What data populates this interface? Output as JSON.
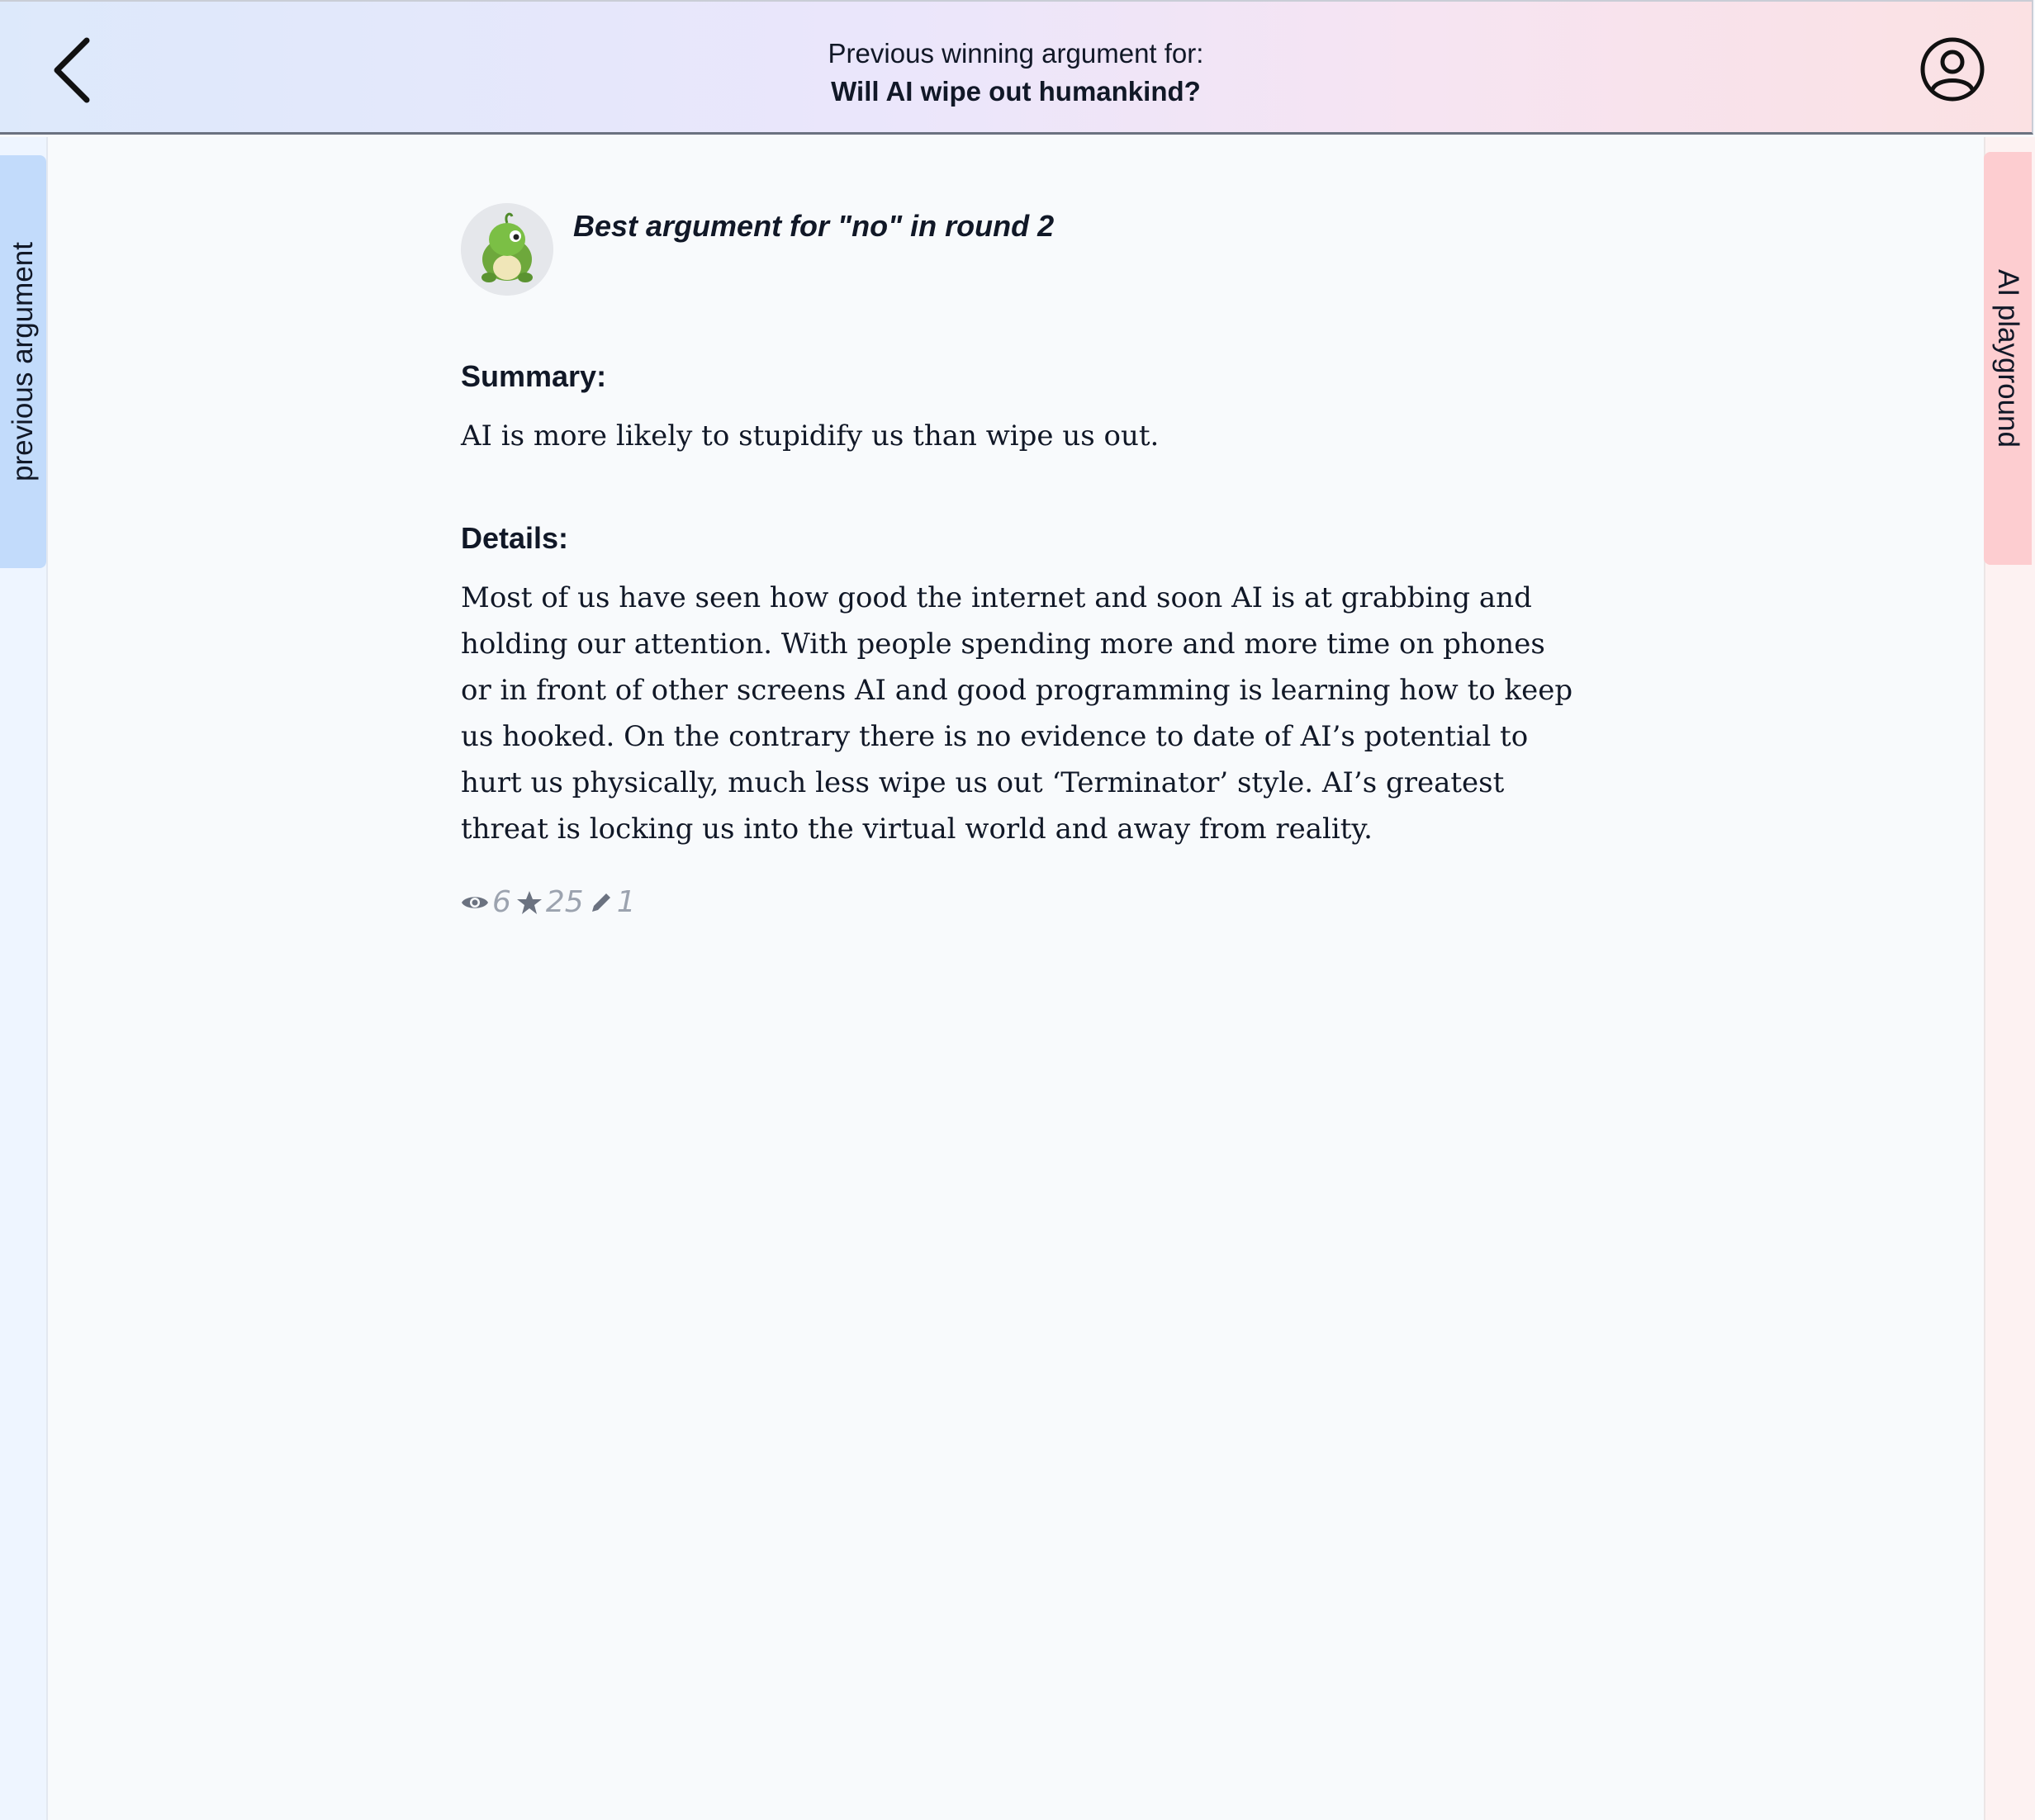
{
  "header": {
    "subtitle": "Previous winning argument for:",
    "title": "Will AI wipe out humankind?",
    "back_icon": "chevron-left-icon",
    "profile_icon": "user-circle-icon"
  },
  "side_tabs": {
    "left_label": "previous argument",
    "right_label": "AI playground",
    "left_color": "#c2dbfb",
    "right_color": "#fdcdd0"
  },
  "argument": {
    "avatar": "frog-avatar",
    "round_title": "Best argument for \"no\" in round 2",
    "summary_label": "Summary:",
    "summary_text": "AI is more likely to stupidify us than wipe us out.",
    "details_label": "Details:",
    "details_text": "Most of us have seen how good the internet and soon AI is at grabbing and holding our attention. With people spending more and more time on phones or in front of other screens AI and good programming is learning how to keep us hooked. On the contrary there is no evidence to date of AI’s potential to hurt us physically, much less wipe us out ‘Terminator’ style. AI’s greatest threat is locking us into the virtual world and away from reality."
  },
  "stats": {
    "views": "6",
    "stars": "25",
    "edits": "1",
    "views_icon": "eye-icon",
    "stars_icon": "star-icon",
    "edits_icon": "pencil-icon"
  }
}
